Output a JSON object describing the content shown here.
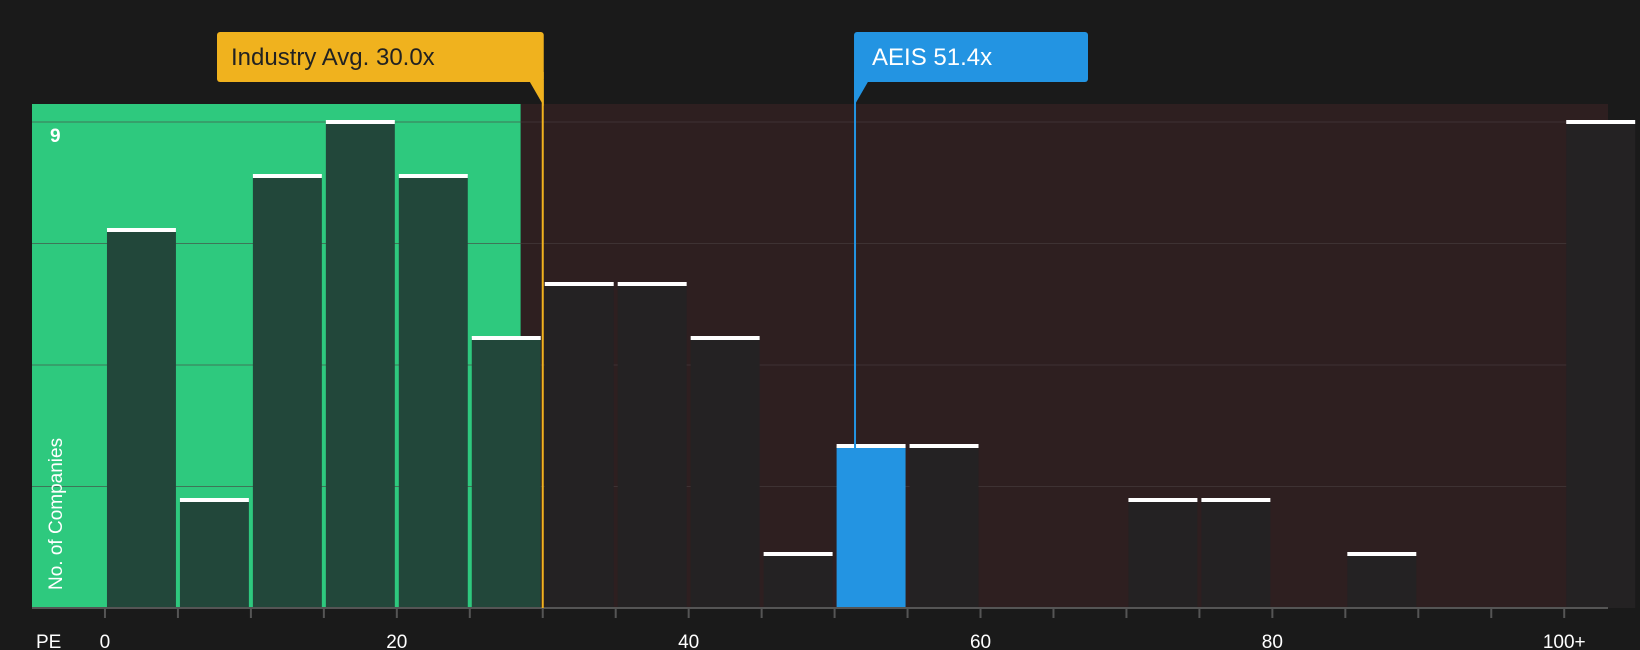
{
  "chart_data": {
    "type": "bar",
    "title": "",
    "xlabel": "PE",
    "ylabel": "No. of Companies",
    "ylim": [
      0,
      9
    ],
    "xlim": [
      -5,
      103
    ],
    "x_ticks": [
      {
        "value": 0,
        "label": "0"
      },
      {
        "value": 20,
        "label": "20"
      },
      {
        "value": 40,
        "label": "40"
      },
      {
        "value": 60,
        "label": "60"
      },
      {
        "value": 80,
        "label": "80"
      },
      {
        "value": 100,
        "label": "100+"
      }
    ],
    "y_top_label": "9",
    "bin_width": 5,
    "bins": [
      {
        "start": 0,
        "value": 7
      },
      {
        "start": 5,
        "value": 2
      },
      {
        "start": 10,
        "value": 8
      },
      {
        "start": 15,
        "value": 9
      },
      {
        "start": 20,
        "value": 8
      },
      {
        "start": 25,
        "value": 5
      },
      {
        "start": 30,
        "value": 6
      },
      {
        "start": 35,
        "value": 6
      },
      {
        "start": 40,
        "value": 5
      },
      {
        "start": 45,
        "value": 1
      },
      {
        "start": 50,
        "value": 3,
        "highlight": true
      },
      {
        "start": 55,
        "value": 3
      },
      {
        "start": 70,
        "value": 2
      },
      {
        "start": 75,
        "value": 2
      },
      {
        "start": 85,
        "value": 1
      },
      {
        "start": 100,
        "value": 9
      }
    ],
    "industry_avg": {
      "value": 30.0,
      "label": "Industry Avg. 30.0x"
    },
    "company": {
      "value": 51.4,
      "label": "AEIS 51.4x"
    },
    "colors": {
      "background": "#1a1a1a",
      "undervalued_zone": "#2ec97e",
      "overvalued_zone": "#2e1f20",
      "bar_in_green": "#22473a",
      "bar_default": "#242223",
      "bar_highlight": "#2394e2",
      "bar_cap": "#ffffff",
      "industry_marker": "#f0b21e",
      "company_marker": "#2394e2",
      "grid": "#4a4040",
      "axis": "#555555"
    }
  }
}
